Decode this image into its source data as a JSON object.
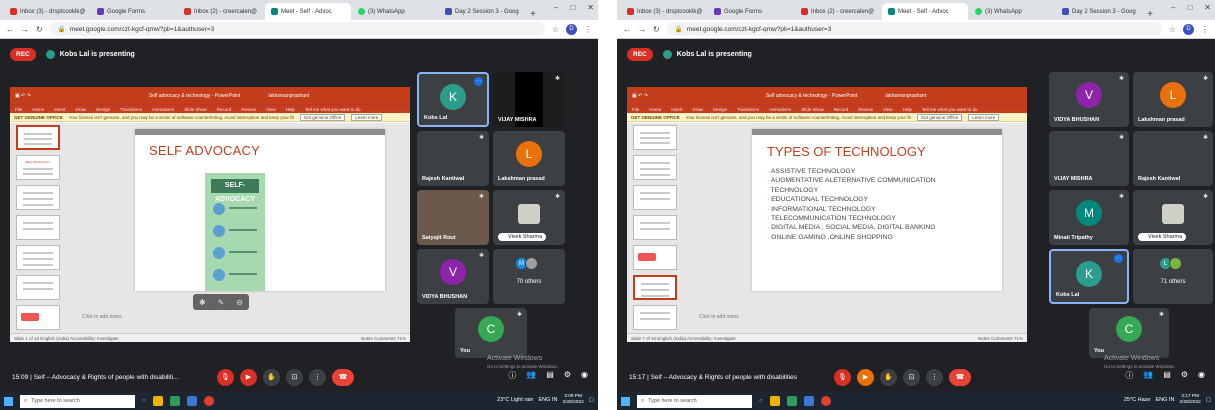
{
  "screens": [
    {
      "tabs": [
        "Inbox (3) - drsptcooklk@",
        "Google Forms",
        "Inbox (2) - creercalen@",
        "Meet - Self - Advoc",
        "(3) WhatsApp",
        "Day 2 Session 3 - Goog"
      ],
      "url": "meet.google.com/czt-kgcf-qmw?pli=1&authuser=3",
      "rec": "REC",
      "presenter": "Kobs Lal is presenting",
      "pp_title": "Self advocacy & technology - PowerPoint",
      "pp_user": "lakhsmanprashant",
      "pp_tell_me": "Tell me what you want to do",
      "ribbon_menu": [
        "File",
        "Home",
        "Insert",
        "Draw",
        "Design",
        "Transitions",
        "Animations",
        "Slide Show",
        "Record",
        "Review",
        "View",
        "Help"
      ],
      "warning_label": "GET GENUINE OFFICE",
      "warning_text": "Your license isn't genuine, and you may be a victim of software counterfeiting. Avoid interruption and keep your files safe with genuine Office today.",
      "warning_btn1": "Get genuine Office",
      "warning_btn2": "Learn more",
      "slide_title": "SELF ADVOCACY",
      "poster_title": "SELF-ADVOCACY",
      "thumb_caption": "SELF ADVOCACY",
      "notes": "Click to add notes",
      "status_left": "Slide 1 of 10    English (India)    Accessibility: Investigate",
      "status_right": "Notes    Comments    71%",
      "participants": [
        {
          "letter": "K",
          "name": "Kobs Lal",
          "color": "#2a9d8f"
        },
        {
          "letter": "",
          "name": "VIJAY MISHRA",
          "color": ""
        },
        {
          "letter": "",
          "name": "Rajesh Kantiwal",
          "color": ""
        },
        {
          "letter": "L",
          "name": "Lakshman prasad",
          "color": "#e8710a"
        },
        {
          "letter": "",
          "name": "Satyajit Rout",
          "color": ""
        },
        {
          "letter": "",
          "name": "Vivek Sharma",
          "color": ""
        },
        {
          "letter": "V",
          "name": "VIDYA BHUSHAN",
          "color": "#8e24aa"
        },
        {
          "letter": "M",
          "name": "70 others",
          "color": "#1e88e5"
        }
      ],
      "you": {
        "letter": "C",
        "name": "You",
        "color": "#34a853"
      },
      "meeting_title": "15:09 | Self – Advocacy & Rights of people with disabiliti...",
      "activate_title": "Activate Windows",
      "activate_sub": "Go to Settings to activate Windows.",
      "search_placeholder": "Type here to search",
      "weather": "23°C  Light rain",
      "lang": "ENG IN",
      "time": "3:09 PM",
      "date": "2/28/2022"
    },
    {
      "tabs": [
        "Inbox (3) - drsptcooklk@",
        "Google Forms",
        "Inbox (2) - creercalen@",
        "Meet - Self - Advoc",
        "(3) WhatsApp",
        "Day 2 Session 3 - Goog"
      ],
      "url": "meet.google.com/czt-kgcf-qmw?pli=1&authuser=3",
      "rec": "REC",
      "presenter": "Kobs Lal is presenting",
      "pp_title": "Self advocacy & technology - PowerPoint",
      "pp_user": "lakhsmanprashant",
      "pp_tell_me": "Tell me what you want to do",
      "ribbon_menu": [
        "File",
        "Home",
        "Insert",
        "Draw",
        "Design",
        "Transitions",
        "Animations",
        "Slide Show",
        "Record",
        "Review",
        "View",
        "Help"
      ],
      "warning_label": "GET GENUINE OFFICE",
      "warning_text": "Your license isn't genuine, and you may be a victim of software counterfeiting. Avoid interruption and keep your files safe with genuine Office today.",
      "warning_btn1": "Get genuine Office",
      "warning_btn2": "Learn more",
      "slide_title": "TYPES OF TECHNOLOGY",
      "tech_items": [
        "· ASSISTIVE TECHNOLOGY",
        "· AUGMENTATIVE ALETERNATIVE COMMUNICATION",
        "  TECHNOLOGY",
        "· EDUCATIONAL TECHNOLOGY",
        "· INFORMATIONAL TECHNOLOGY",
        "· TELECOMMUNICATION TECHNOLOGY",
        "· DIGITAL MEDIA , SOCIAL MEDIA, DIGITAL BANKING",
        "· ONLINE GAMING ,ONLINE SHOPPING"
      ],
      "notes": "Click to add notes",
      "status_left": "Slide 7 of 10    English (India)    Accessibility: Investigate",
      "status_right": "Notes    Comments    71%",
      "participants": [
        {
          "letter": "V",
          "name": "VIDYA BHUSHAN",
          "color": "#8e24aa"
        },
        {
          "letter": "L",
          "name": "Lakshman prasad",
          "color": "#e8710a"
        },
        {
          "letter": "",
          "name": "VIJAY MISHRA",
          "color": ""
        },
        {
          "letter": "",
          "name": "Rajesh Kantiwal",
          "color": ""
        },
        {
          "letter": "M",
          "name": "Minati Tripathy",
          "color": "#00897b"
        },
        {
          "letter": "",
          "name": "Vivek Sharma",
          "color": ""
        },
        {
          "letter": "K",
          "name": "Kobs Lal",
          "color": "#2a9d8f"
        },
        {
          "letter": "L",
          "name": "71 others",
          "color": "#2a9d8f"
        }
      ],
      "you": {
        "letter": "C",
        "name": "You",
        "color": "#34a853"
      },
      "meeting_title": "15:17 | Self – Advocacy & Rights of people with disabilities",
      "activate_title": "Activate Windows",
      "activate_sub": "Go to Settings to activate Windows.",
      "search_placeholder": "Type here to search",
      "weather": "25°C  Haze",
      "lang": "ENG IN",
      "time": "3:17 PM",
      "date": "2/28/2022"
    }
  ]
}
